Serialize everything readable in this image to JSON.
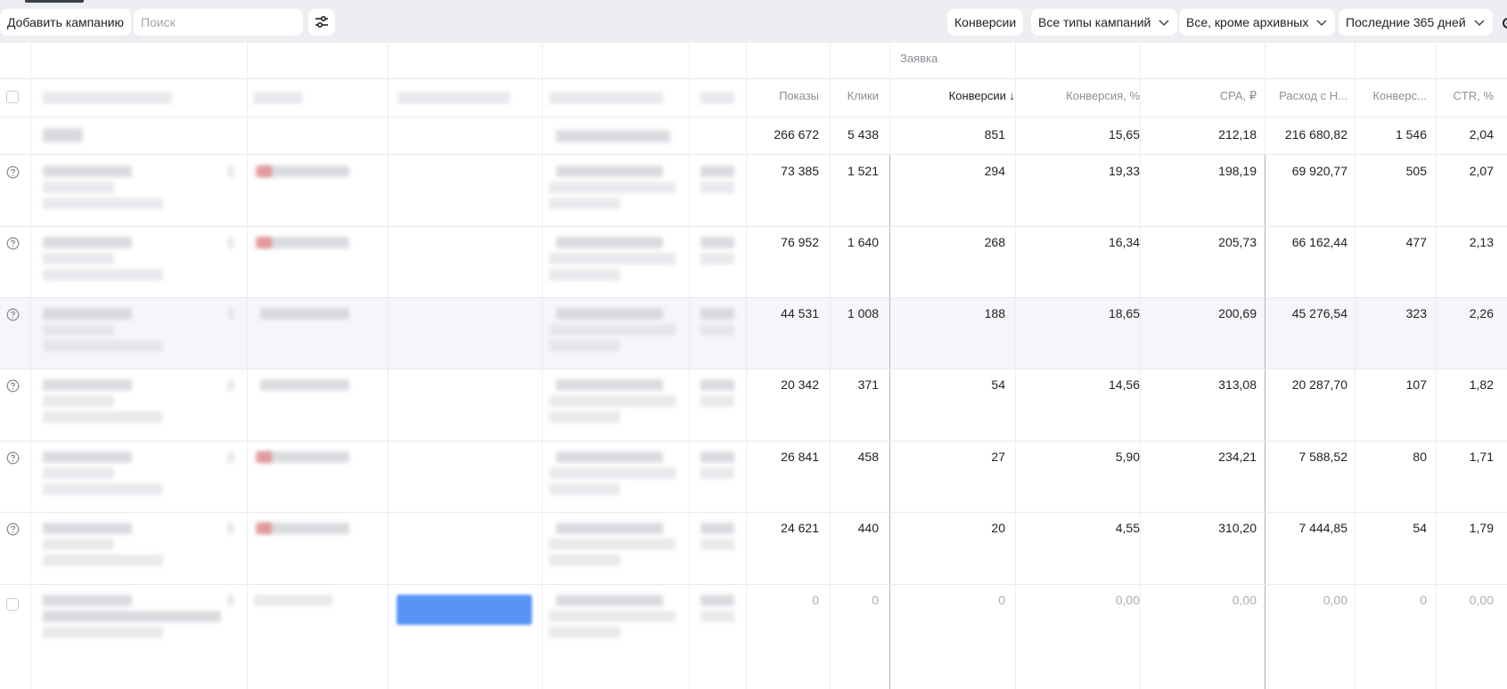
{
  "toolbar": {
    "add_campaign": "Добавить кампанию",
    "search_placeholder": "Поиск",
    "conversions": "Конверсии",
    "campaign_types": "Все типы кампаний",
    "status_filter": "Все, кроме архивных",
    "period": "Последние 365 дней"
  },
  "table": {
    "group_label": "Заявка",
    "columns": {
      "impressions": "Показы",
      "clicks": "Клики",
      "conversions": "Конверсии ↓",
      "conversion_rate": "Конверсия, %",
      "cpa": "CPA, ₽",
      "spend": "Расход с Н...",
      "conversions2": "Конверс...",
      "ctr": "CTR, %"
    },
    "totals": {
      "impressions": "266 672",
      "clicks": "5 438",
      "conversions": "851",
      "conversion_rate": "15,65",
      "cpa": "212,18",
      "spend": "216 680,82",
      "conversions2": "1 546",
      "ctr": "2,04"
    },
    "rows": [
      {
        "impressions": "73 385",
        "clicks": "1 521",
        "conversions": "294",
        "conversion_rate": "19,33",
        "cpa": "198,19",
        "spend": "69 920,77",
        "conversions2": "505",
        "ctr": "2,07"
      },
      {
        "impressions": "76 952",
        "clicks": "1 640",
        "conversions": "268",
        "conversion_rate": "16,34",
        "cpa": "205,73",
        "spend": "66 162,44",
        "conversions2": "477",
        "ctr": "2,13"
      },
      {
        "impressions": "44 531",
        "clicks": "1 008",
        "conversions": "188",
        "conversion_rate": "18,65",
        "cpa": "200,69",
        "spend": "45 276,54",
        "conversions2": "323",
        "ctr": "2,26"
      },
      {
        "impressions": "20 342",
        "clicks": "371",
        "conversions": "54",
        "conversion_rate": "14,56",
        "cpa": "313,08",
        "spend": "20 287,70",
        "conversions2": "107",
        "ctr": "1,82"
      },
      {
        "impressions": "26 841",
        "clicks": "458",
        "conversions": "27",
        "conversion_rate": "5,90",
        "cpa": "234,21",
        "spend": "7 588,52",
        "conversions2": "80",
        "ctr": "1,71"
      },
      {
        "impressions": "24 621",
        "clicks": "440",
        "conversions": "20",
        "conversion_rate": "4,55",
        "cpa": "310,20",
        "spend": "7 444,85",
        "conversions2": "54",
        "ctr": "1,79"
      },
      {
        "impressions": "0",
        "clicks": "0",
        "conversions": "0",
        "conversion_rate": "0,00",
        "cpa": "0,00",
        "spend": "0,00",
        "conversions2": "0",
        "ctr": "0,00"
      }
    ]
  }
}
